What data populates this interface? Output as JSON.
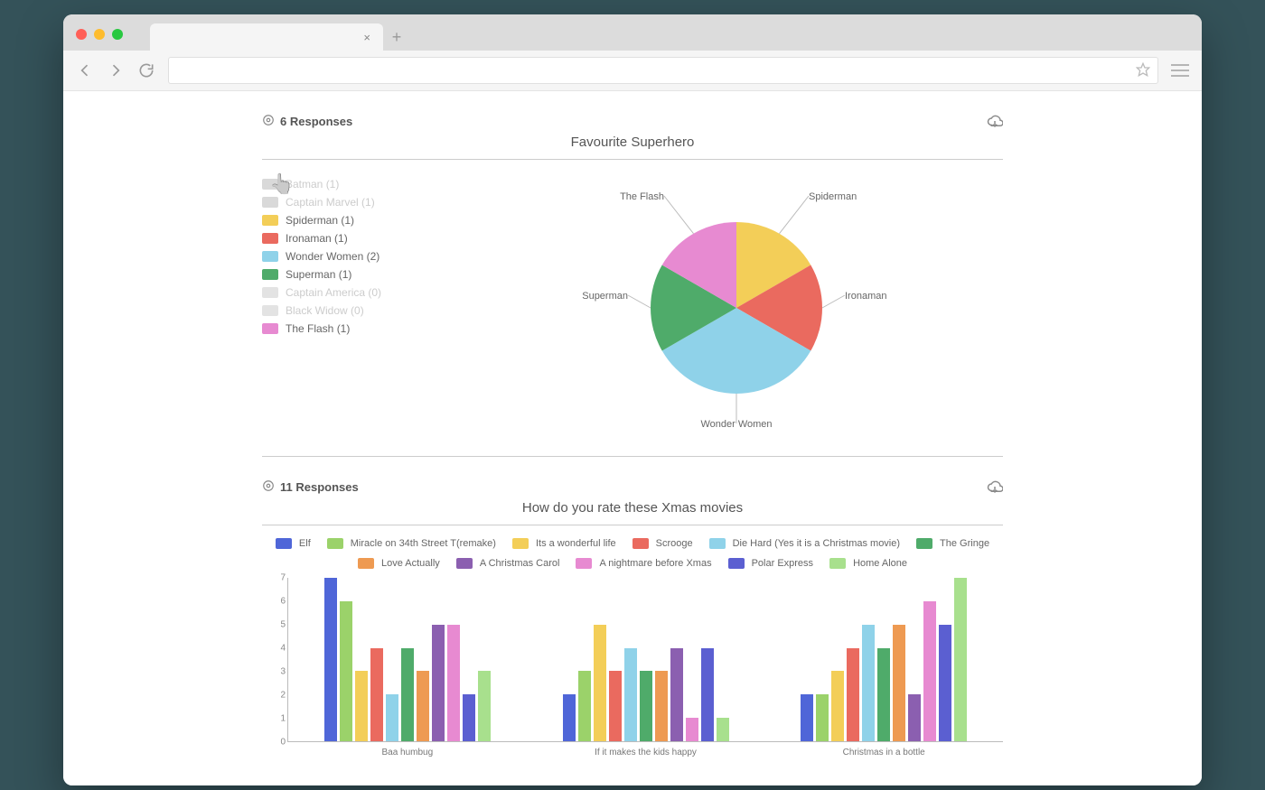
{
  "browser": {
    "tab_close": "×",
    "tab_add": "+"
  },
  "colors": {
    "blue": "#4f66d8",
    "lime": "#9bd26a",
    "yellow": "#f3ce58",
    "red": "#ea6a5f",
    "sky": "#8fd2e9",
    "green": "#4fab6a",
    "orange": "#ee9a52",
    "purple": "#8b5fb0",
    "pink": "#e78ad1",
    "indigo": "#5b5fd1",
    "lightgreen": "#a8e08d"
  },
  "section1": {
    "responses": "6 Responses",
    "title": "Favourite Superhero",
    "legend": [
      {
        "label": "Batman (1)",
        "color": "#d9d9d9",
        "dim": true
      },
      {
        "label": "Captain Marvel (1)",
        "color": "#d9d9d9",
        "dim": true
      },
      {
        "label": "Spiderman (1)",
        "color": "#f3ce58"
      },
      {
        "label": "Ironaman (1)",
        "color": "#ea6a5f"
      },
      {
        "label": "Wonder Women (2)",
        "color": "#8fd2e9"
      },
      {
        "label": "Superman (1)",
        "color": "#4fab6a"
      },
      {
        "label": "Captain America (0)",
        "color": "#e3e3e3",
        "dim": true
      },
      {
        "label": "Black Widow (0)",
        "color": "#e3e3e3",
        "dim": true
      },
      {
        "label": "The Flash (1)",
        "color": "#e78ad1"
      }
    ],
    "pie_labels": [
      "The Flash",
      "Spiderman",
      "Ironaman",
      "Wonder Women",
      "Superman"
    ]
  },
  "section2": {
    "responses": "11 Responses",
    "title": "How do you rate these Xmas movies",
    "movies": [
      {
        "name": "Elf",
        "color": "#4f66d8"
      },
      {
        "name": "Miracle on 34th Street T(remake)",
        "color": "#9bd26a"
      },
      {
        "name": "Its a wonderful life",
        "color": "#f3ce58"
      },
      {
        "name": "Scrooge",
        "color": "#ea6a5f"
      },
      {
        "name": "Die Hard (Yes it is a Christmas movie)",
        "color": "#8fd2e9"
      },
      {
        "name": "The Gringe",
        "color": "#4fab6a"
      },
      {
        "name": "Love Actually",
        "color": "#ee9a52"
      },
      {
        "name": "A Christmas Carol",
        "color": "#8b5fb0"
      },
      {
        "name": "A nightmare before Xmas",
        "color": "#e78ad1"
      },
      {
        "name": "Polar Express",
        "color": "#5b5fd1"
      },
      {
        "name": "Home Alone",
        "color": "#a8e08d"
      }
    ],
    "categories": [
      "Baa humbug",
      "If it makes the kids happy",
      "Christmas in a bottle"
    ],
    "ymax": 7
  },
  "chart_data": [
    {
      "type": "pie",
      "title": "Favourite Superhero",
      "series": [
        {
          "name": "Spiderman",
          "value": 1,
          "color": "#f3ce58"
        },
        {
          "name": "Ironaman",
          "value": 1,
          "color": "#ea6a5f"
        },
        {
          "name": "Wonder Women",
          "value": 2,
          "color": "#8fd2e9"
        },
        {
          "name": "Superman",
          "value": 1,
          "color": "#4fab6a"
        },
        {
          "name": "The Flash",
          "value": 1,
          "color": "#e78ad1"
        }
      ]
    },
    {
      "type": "bar",
      "title": "How do you rate these Xmas movies",
      "categories": [
        "Baa humbug",
        "If it makes the kids happy",
        "Christmas in a bottle"
      ],
      "ylim": [
        0,
        7
      ],
      "series": [
        {
          "name": "Elf",
          "color": "#4f66d8",
          "values": [
            7,
            2,
            2
          ]
        },
        {
          "name": "Miracle on 34th Street T(remake)",
          "color": "#9bd26a",
          "values": [
            6,
            3,
            2
          ]
        },
        {
          "name": "Its a wonderful life",
          "color": "#f3ce58",
          "values": [
            3,
            5,
            3
          ]
        },
        {
          "name": "Scrooge",
          "color": "#ea6a5f",
          "values": [
            4,
            3,
            4
          ]
        },
        {
          "name": "Die Hard (Yes it is a Christmas movie)",
          "color": "#8fd2e9",
          "values": [
            2,
            4,
            5
          ]
        },
        {
          "name": "The Gringe",
          "color": "#4fab6a",
          "values": [
            4,
            3,
            4
          ]
        },
        {
          "name": "Love Actually",
          "color": "#ee9a52",
          "values": [
            3,
            3,
            5
          ]
        },
        {
          "name": "A Christmas Carol",
          "color": "#8b5fb0",
          "values": [
            5,
            4,
            2
          ]
        },
        {
          "name": "A nightmare before Xmas",
          "color": "#e78ad1",
          "values": [
            5,
            1,
            6
          ]
        },
        {
          "name": "Polar Express",
          "color": "#5b5fd1",
          "values": [
            2,
            4,
            5
          ]
        },
        {
          "name": "Home Alone",
          "color": "#a8e08d",
          "values": [
            3,
            1,
            7
          ]
        }
      ]
    }
  ]
}
